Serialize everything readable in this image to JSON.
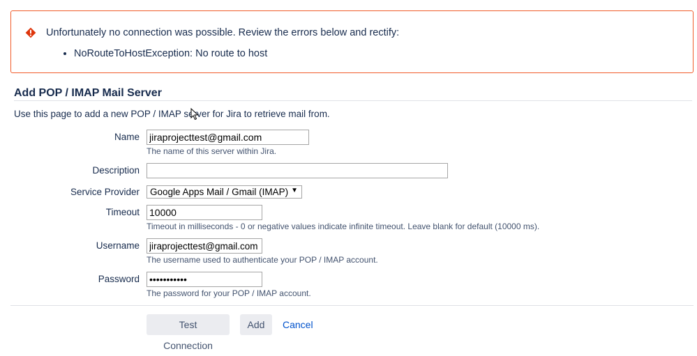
{
  "error": {
    "title": "Unfortunately no connection was possible. Review the errors below and rectify:",
    "items": [
      "NoRouteToHostException: No route to host"
    ],
    "icon": "error-icon",
    "color": "#de350b"
  },
  "page": {
    "title": "Add POP / IMAP Mail Server",
    "intro": "Use this page to add a new POP / IMAP server for Jira to retrieve mail from."
  },
  "form": {
    "name": {
      "label": "Name",
      "value": "jiraprojecttest@gmail.com",
      "help": "The name of this server within Jira."
    },
    "description": {
      "label": "Description",
      "value": ""
    },
    "service_provider": {
      "label": "Service Provider",
      "selected": "Google Apps Mail / Gmail (IMAP)"
    },
    "timeout": {
      "label": "Timeout",
      "value": "10000",
      "help": "Timeout in milliseconds - 0 or negative values indicate infinite timeout. Leave blank for default (10000 ms)."
    },
    "username": {
      "label": "Username",
      "value": "jiraprojecttest@gmail.com",
      "help": "The username used to authenticate your POP / IMAP account."
    },
    "password": {
      "label": "Password",
      "value": "password123",
      "help": "The password for your POP / IMAP account."
    }
  },
  "actions": {
    "test_label": "Test Connection",
    "add_label": "Add",
    "cancel_label": "Cancel"
  },
  "colors": {
    "accent": "#0052cc",
    "error_border": "#f15c2b",
    "button_bg": "#ebecf0"
  }
}
